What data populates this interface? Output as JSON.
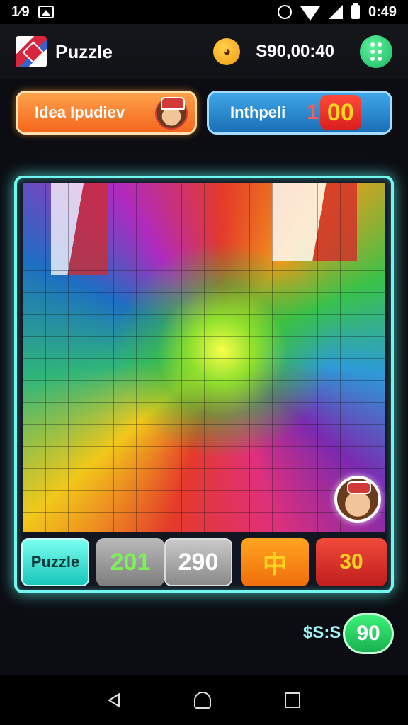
{
  "status_bar": {
    "time_left": "1⁄9",
    "time_right": "0:49"
  },
  "header": {
    "title": "Puzzle",
    "balance": "S90,00:40",
    "coin_icon": "fox-coin-icon",
    "menu_icon": "grid-dots-icon"
  },
  "top_buttons": {
    "left_label": "Idea Ipudiev",
    "right_label": "Inthpeli",
    "right_prefix": "1",
    "right_score": "00"
  },
  "board": {
    "tiles": {
      "puzzle": "Puzzle",
      "a": "201",
      "b": "290",
      "c": "中",
      "d": "30"
    }
  },
  "counter": {
    "label": "$S:S",
    "value": "90"
  },
  "colors": {
    "board_border": "#6ff7f0",
    "accent_green": "#1cb866",
    "accent_orange": "#f4661d",
    "accent_blue": "#1a6fb6"
  }
}
